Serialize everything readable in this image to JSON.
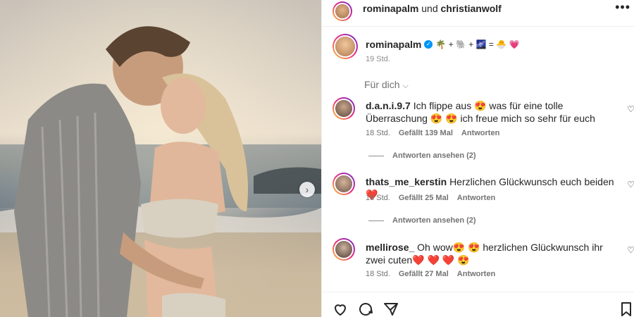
{
  "header": {
    "user1": "rominapalm",
    "connector": "und",
    "user2": "christianwolf",
    "more_icon": "more-horizontal-icon"
  },
  "caption": {
    "username": "rominapalm",
    "text": "🌴 + 🐘 + 🌌 = 🐣 💗",
    "time": "19 Std."
  },
  "for_you_label": "Für dich",
  "comments": [
    {
      "username": "d.a.n.i.9.7",
      "text": "Ich flippe aus 😍 was für eine tolle Überraschung 😍 😍 ich freue mich so sehr für euch",
      "time": "18 Std.",
      "likes": "Gefällt 139 Mal",
      "reply": "Antworten",
      "view_replies": "Antworten ansehen (2)"
    },
    {
      "username": "thats_me_kerstin",
      "text": "Herzlichen Glückwunsch euch beiden ❤️",
      "time": "18 Std.",
      "likes": "Gefällt 25 Mal",
      "reply": "Antworten",
      "view_replies": "Antworten ansehen (2)"
    },
    {
      "username": "mellirose_",
      "text": "Oh wow😍 😍 herzlichen Glückwunsch ihr zwei cuten❤️ ❤️ ❤️ 😍",
      "time": "18 Std.",
      "likes": "Gefällt 27 Mal",
      "reply": "Antworten"
    }
  ],
  "colors": {
    "verified": "#0095f6",
    "muted": "#737373",
    "text": "#262626"
  }
}
